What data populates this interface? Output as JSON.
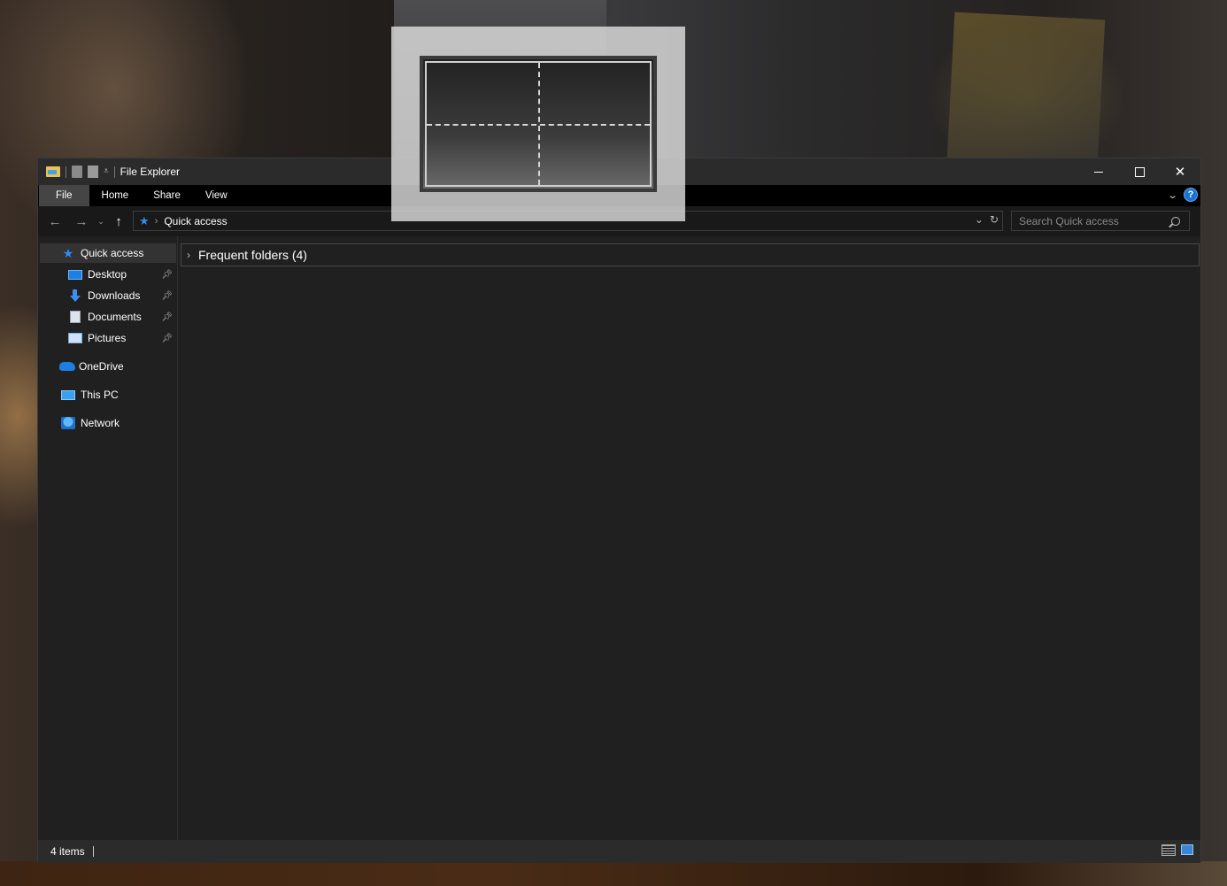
{
  "window": {
    "title": "File Explorer"
  },
  "quick_access_toolbar": {
    "icons": [
      "folder-icon",
      "properties-icon",
      "new-folder-icon",
      "customize-dropdown-icon"
    ]
  },
  "window_controls": {
    "minimize": "—",
    "maximize": "☐",
    "close": "✕"
  },
  "ribbon": {
    "tabs": [
      {
        "label": "File",
        "active": true
      },
      {
        "label": "Home"
      },
      {
        "label": "Share"
      },
      {
        "label": "View"
      }
    ],
    "help_icon": "?",
    "expand_icon": "chevron-down-icon"
  },
  "navbar": {
    "back": "←",
    "forward": "→",
    "recent": "⌄",
    "up": "↑",
    "breadcrumb": {
      "icon": "star-icon",
      "separator": "›",
      "location": "Quick access"
    },
    "address_dropdown": "⌄",
    "refresh": "↻",
    "search_placeholder": "Search Quick access"
  },
  "sidebar": {
    "items": [
      {
        "label": "Quick access",
        "icon": "star-icon",
        "selected": true
      },
      {
        "label": "Desktop",
        "icon": "desktop-icon",
        "pinned": true
      },
      {
        "label": "Downloads",
        "icon": "downloads-icon",
        "pinned": true
      },
      {
        "label": "Documents",
        "icon": "documents-icon",
        "pinned": true
      },
      {
        "label": "Pictures",
        "icon": "pictures-icon",
        "pinned": true
      },
      {
        "label": "OneDrive",
        "icon": "onedrive-icon"
      },
      {
        "label": "This PC",
        "icon": "computer-icon"
      },
      {
        "label": "Network",
        "icon": "network-icon"
      }
    ],
    "pin_glyph": "📌"
  },
  "content": {
    "group": {
      "title": "Frequent folders (4)",
      "expanded": false,
      "chevron": "›"
    }
  },
  "statusbar": {
    "item_count": "4 items"
  },
  "snap_overlay": {
    "layout": "quadrants"
  },
  "colors": {
    "accent": "#2f8ef0",
    "window_bg": "#202020",
    "titlebar_bg": "#2b2b2b",
    "ribbon_bg": "#000000",
    "file_tab_bg": "#454545",
    "selected_item_bg": "#333333"
  }
}
